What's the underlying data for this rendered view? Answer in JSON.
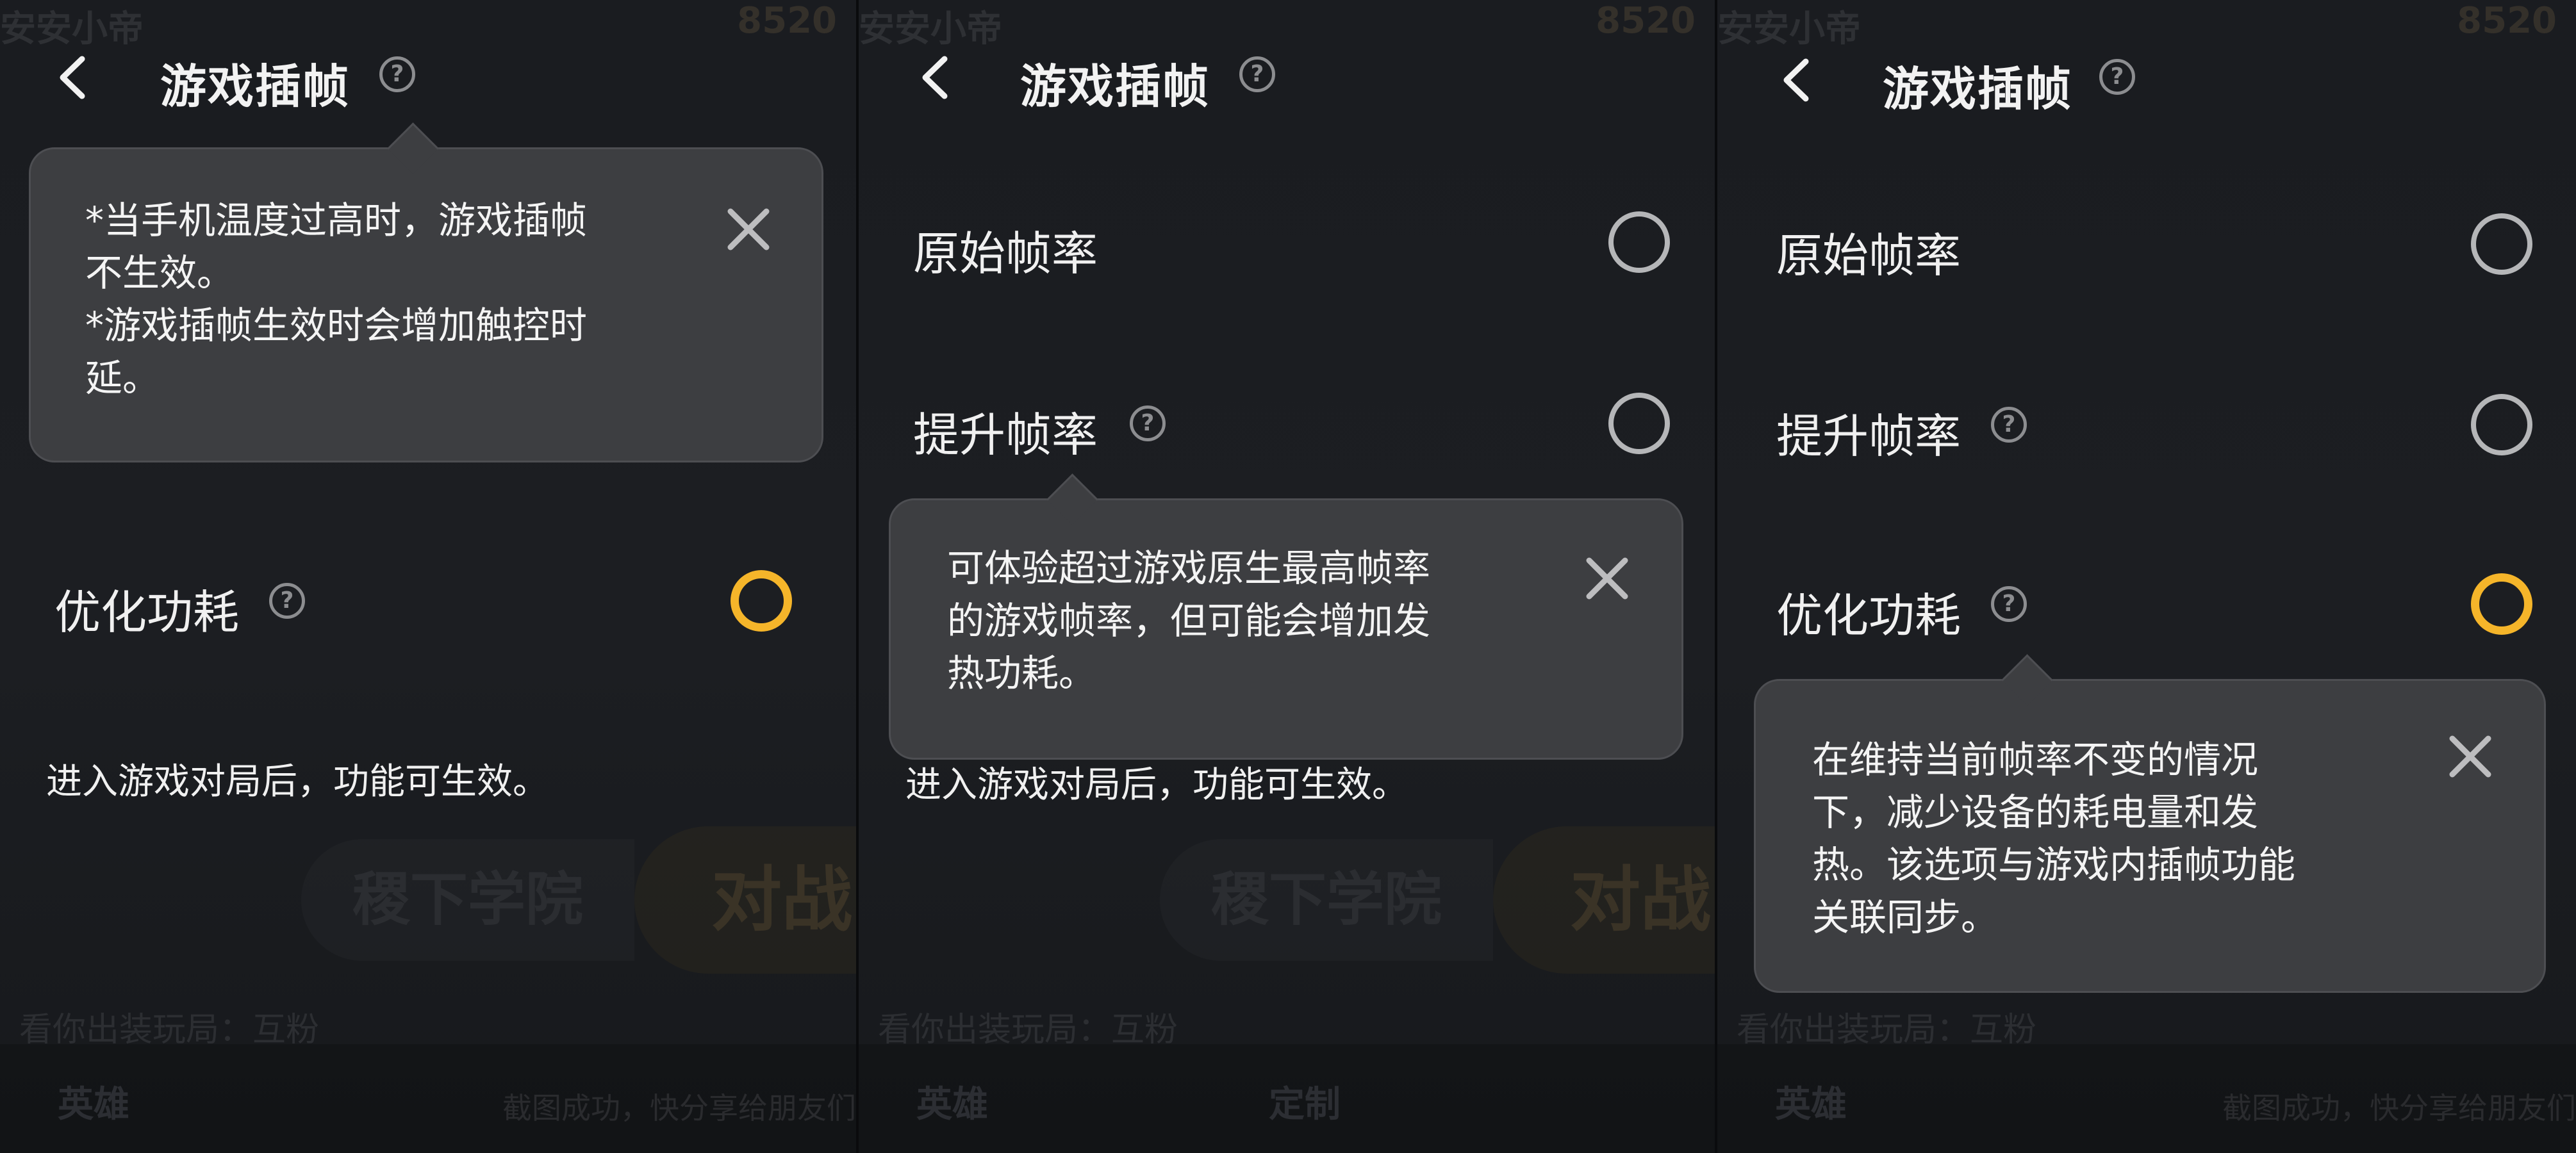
{
  "common": {
    "title": "游戏插帧",
    "help_glyph": "?",
    "options": {
      "original": "原始帧率",
      "boost": "提升帧率",
      "optimize": "优化功耗"
    },
    "effective_note": "进入游戏对局后，功能可生效。"
  },
  "background": {
    "status_left": "安安小帝",
    "coins": "8520",
    "academy": "稷下学院",
    "battle": "对战",
    "hint": "看你出装玩局：互粉",
    "nav_hero": "英雄",
    "nav_custom": "定制",
    "toast": "截图成功，快分享给朋友们"
  },
  "panel1": {
    "selected": "optimize",
    "tooltip_lines": [
      "*当手机温度过高时，游戏插帧",
      "不生效。",
      "*游戏插帧生效时会增加触控时",
      "延。"
    ]
  },
  "panel2": {
    "selected": "none",
    "tooltip_lines": [
      "可体验超过游戏原生最高帧率",
      "的游戏帧率，但可能会增加发",
      "热功耗。"
    ]
  },
  "panel3": {
    "selected": "optimize",
    "tooltip_lines": [
      "在维持当前帧率不变的情况",
      "下，减少设备的耗电量和发",
      "热。该选项与游戏内插帧功能",
      "关联同步。"
    ]
  },
  "colors": {
    "accent": "#f5b52a",
    "panel_bg": "#1c1e22",
    "tooltip_bg": "#3d3e41"
  }
}
